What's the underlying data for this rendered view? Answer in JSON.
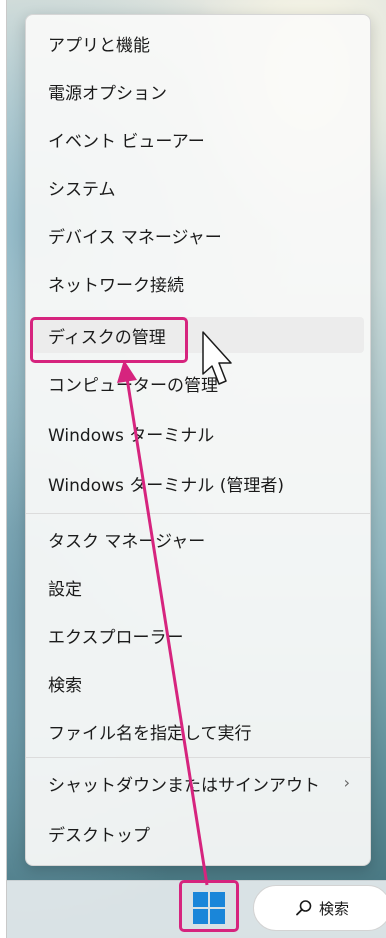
{
  "menu": {
    "items": [
      {
        "label": "アプリと機能"
      },
      {
        "label": "電源オプション"
      },
      {
        "label": "イベント ビューアー"
      },
      {
        "label": "システム"
      },
      {
        "label": "デバイス マネージャー"
      },
      {
        "label": "ネットワーク接続"
      },
      {
        "label": "ディスクの管理"
      },
      {
        "label": "コンピューターの管理"
      },
      {
        "label": "Windows ターミナル"
      },
      {
        "label": "Windows ターミナル (管理者)"
      },
      {
        "label": "タスク マネージャー"
      },
      {
        "label": "設定"
      },
      {
        "label": "エクスプローラー"
      },
      {
        "label": "検索"
      },
      {
        "label": "ファイル名を指定して実行"
      },
      {
        "label": "シャットダウンまたはサインアウト",
        "chevron": "›"
      },
      {
        "label": "デスクトップ"
      }
    ],
    "highlighted_item": "ディスクの管理"
  },
  "taskbar": {
    "start_icon": "windows-logo-icon",
    "search_label": "検索",
    "search_icon": "search-icon"
  },
  "annotation_color": "#d6247e",
  "accent_color": "#1a86d9"
}
